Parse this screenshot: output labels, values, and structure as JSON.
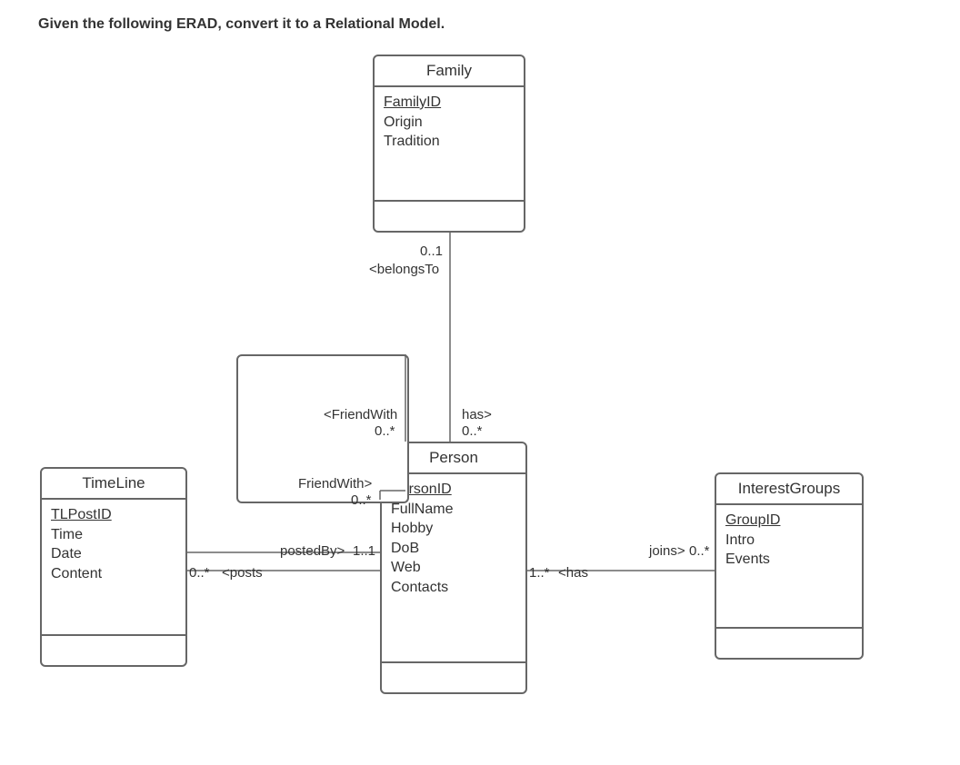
{
  "prompt": "Given the following ERAD, convert it to a Relational Model.",
  "entities": {
    "family": {
      "title": "Family",
      "attrs": [
        "FamilyID",
        "Origin",
        "Tradition"
      ],
      "pk": "FamilyID"
    },
    "timeline": {
      "title": "TimeLine",
      "attrs": [
        "TLPostID",
        "Time",
        "Date",
        "Content"
      ],
      "pk": "TLPostID"
    },
    "person": {
      "title": "Person",
      "attrs": [
        "PersonID",
        "FullName",
        "Hobby",
        "DoB",
        "Web",
        "Contacts"
      ],
      "pk": "PersonID"
    },
    "interestgroups": {
      "title": "InterestGroups",
      "attrs": [
        "GroupID",
        "Intro",
        "Events"
      ],
      "pk": "GroupID"
    }
  },
  "labels": {
    "belongs_card": "0..1",
    "belongs_name": "<belongsTo",
    "has_name": "has>",
    "has_card": "0..*",
    "friendwith_top_name": "<FriendWith",
    "friendwith_top_card": "0..*",
    "friendwith_side_name": "FriendWith>",
    "friendwith_side_card": "0..*",
    "postedby_name": "postedBy>",
    "postedby_card": "1..1",
    "posts_card": "0..*",
    "posts_name": "<posts",
    "personhas_card": "1..*",
    "personhas_name": "<has",
    "joins_name": "joins>",
    "joins_card": "0..*"
  }
}
